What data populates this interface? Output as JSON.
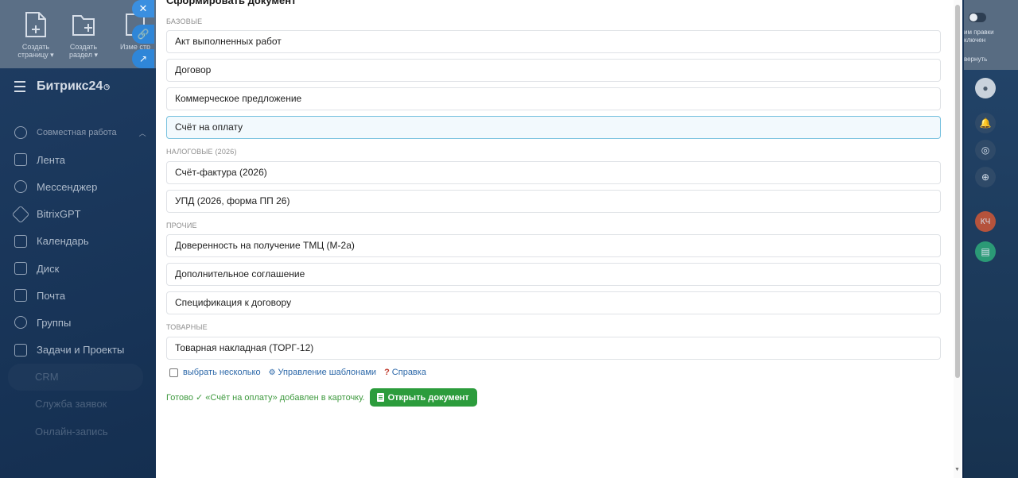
{
  "background": {
    "toolbar": {
      "create_page": "Создать страницу ▾",
      "create_section": "Создать раздел ▾",
      "edit_partial": "Изме стр"
    },
    "app_title": "Битрикс24",
    "menu": [
      {
        "label": "Совместная работа"
      },
      {
        "label": "Лента"
      },
      {
        "label": "Мессенджер"
      },
      {
        "label": "BitrixGPT"
      },
      {
        "label": "Календарь"
      },
      {
        "label": "Диск"
      },
      {
        "label": "Почта"
      },
      {
        "label": "Группы"
      },
      {
        "label": "Задачи и Проекты"
      },
      {
        "label": "CRM"
      },
      {
        "label": "Служба заявок"
      },
      {
        "label": "Онлайн-запись"
      }
    ],
    "right_rail": {
      "mode_text": "им правки ключен",
      "collapse_text": "вернуть",
      "avatar_initials": "КЧ"
    }
  },
  "panel": {
    "title": "Сформировать документ",
    "groups": [
      {
        "label": "БАЗОВЫЕ",
        "items": [
          {
            "label": "Акт выполненных работ",
            "selected": false
          },
          {
            "label": "Договор",
            "selected": false
          },
          {
            "label": "Коммерческое предложение",
            "selected": false
          },
          {
            "label": "Счёт на оплату",
            "selected": true
          }
        ]
      },
      {
        "label": "НАЛОГОВЫЕ (2026)",
        "items": [
          {
            "label": "Счёт-фактура (2026)",
            "selected": false
          },
          {
            "label": "УПД (2026, форма ПП 26)",
            "selected": false
          }
        ]
      },
      {
        "label": "ПРОЧИЕ",
        "items": [
          {
            "label": "Доверенность на получение ТМЦ (М-2а)",
            "selected": false
          },
          {
            "label": "Дополнительное соглашение",
            "selected": false
          },
          {
            "label": "Спецификация к договору",
            "selected": false
          }
        ]
      },
      {
        "label": "ТОВАРНЫЕ",
        "items": [
          {
            "label": "Товарная накладная (ТОРГ-12)",
            "selected": false
          }
        ]
      }
    ],
    "options": {
      "select_multiple": "выбрать несколько",
      "manage_templates": "Управление шаблонами",
      "help": "Справка"
    },
    "status": {
      "text": "Готово ✓ «Счёт на оплату» добавлен в карточку.",
      "open_button": "Открыть документ"
    }
  },
  "colors": {
    "accent_green": "#2c9c3c",
    "selected_border": "#79c2df",
    "link_blue": "#2b67a8",
    "float_button_blue": "#2f86d8"
  }
}
